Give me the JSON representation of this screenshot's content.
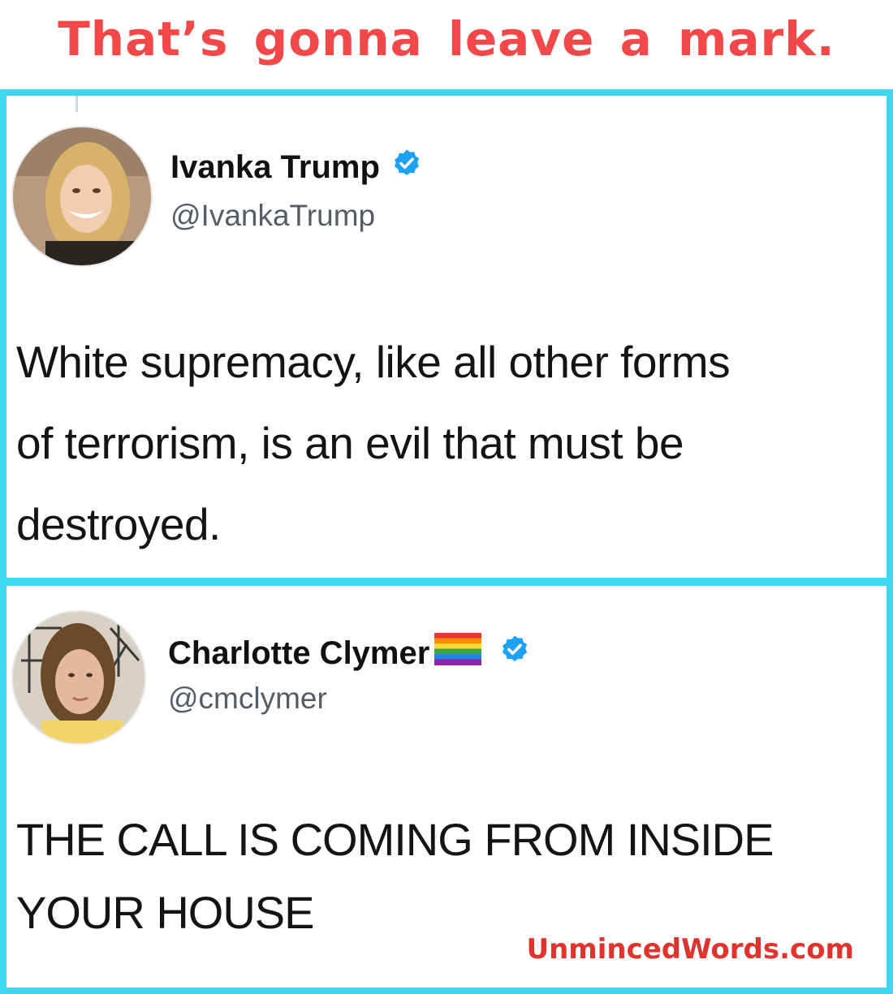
{
  "headline": {
    "text": "That’s gonna leave a mark."
  },
  "tweets": [
    {
      "name": "Ivanka Trump",
      "handle": "@IvankaTrump",
      "text_lines": [
        "White supremacy, like all other forms",
        "of terrorism, is an evil that must be",
        "destroyed."
      ],
      "verified": true,
      "avatar_icon": "profile-photo-icon"
    },
    {
      "name": "Charlotte Clymer",
      "handle": "@cmclymer",
      "text_lines": [
        "THE CALL IS COMING FROM INSIDE",
        "YOUR HOUSE"
      ],
      "verified": true,
      "flag_icon": "rainbow-flag-icon",
      "avatar_icon": "profile-photo-icon"
    }
  ],
  "watermark": {
    "text": "UnmincedWords.com"
  },
  "colors": {
    "headline": "#f2484a",
    "frame": "#3fd6ef",
    "verified": "#1da1f2",
    "watermark": "#e0332e"
  }
}
